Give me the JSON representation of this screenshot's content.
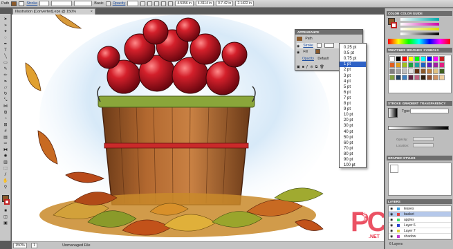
{
  "control_bar": {
    "selection": "Path",
    "stroke_label": "Stroke",
    "stroke_style": "Basic",
    "opacity_label": "Opacity",
    "coordinates": [
      "4.5356 in",
      "4.3114 in",
      "0.7.42 in",
      "2.1422 in"
    ]
  },
  "document": {
    "tab_title": "Illustration [Converted].eps @ 150% (CMYK/Preview)",
    "close": "×"
  },
  "appearance_panel": {
    "title": "APPEARANCE",
    "path_label": "Path",
    "stroke_label": "Stroke",
    "fill_label": "Fill",
    "opacity_label": "Opacity",
    "opacity_value": "Default"
  },
  "stroke_weights": {
    "options": [
      "0.25 pt",
      "0.5 pt",
      "0.75 pt",
      "1 pt",
      "2 pt",
      "3 pt",
      "4 pt",
      "5 pt",
      "6 pt",
      "7 pt",
      "8 pt",
      "9 pt",
      "10 pt",
      "20 pt",
      "30 pt",
      "40 pt",
      "50 pt",
      "60 pt",
      "70 pt",
      "80 pt",
      "90 pt",
      "100 pt"
    ],
    "selected_index": 3
  },
  "dock": {
    "color_tabs": [
      "COLOR",
      "COLOR GUIDE"
    ],
    "swatch_tabs": [
      "SWATCHES",
      "BRUSHES",
      "SYMBOLS"
    ],
    "stroke_tabs": [
      "STROKE",
      "GRADIENT",
      "TRANSPARENCY"
    ],
    "gradient_type_label": "Type:",
    "gradient_fields": [
      "Opacity:",
      "Location:"
    ],
    "graphic_styles_tab": "GRAPHIC STYLES",
    "layers_tab": "LAYERS",
    "layers": [
      "leaves",
      "basket",
      "apples",
      "Layer 6",
      "Layer 7",
      "shadow"
    ],
    "layers_count": "6 Layers"
  },
  "status_bar": {
    "zoom": "150%",
    "page": "1",
    "status": "Unmanaged File"
  },
  "watermark": {
    "big": "PC",
    "small": "MAG",
    "suffix": ".NET"
  },
  "colors": {
    "accent": "#2f62c6",
    "apple_red": "#c0131c",
    "basket_wood": "#a05a2c",
    "band_green": "#7a9a2a"
  }
}
